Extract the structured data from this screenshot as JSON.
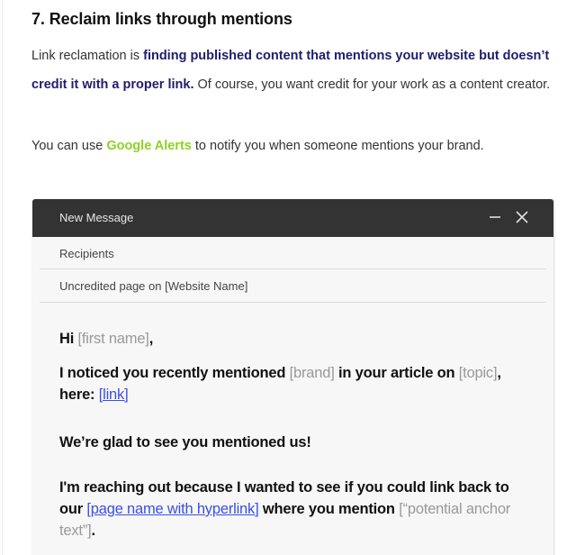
{
  "article": {
    "heading": "7. Reclaim links through mentions",
    "para1": {
      "prefix": "Link reclamation is ",
      "emphasis": "finding published content that mentions your website but doesn’t credit it with a proper link.",
      "suffix": " Of course, you want credit for your work as a content creator."
    },
    "para2": {
      "prefix": "You can use ",
      "link": "Google Alerts",
      "suffix": " to notify you when someone mentions your brand."
    }
  },
  "email": {
    "title": "New Message",
    "controls": {
      "minimize": "minimize-icon",
      "close": "close-icon"
    },
    "recipients_placeholder": "Recipients",
    "subject": "Uncredited page on [Website Name]",
    "greeting": {
      "text": "Hi ",
      "placeholder": "[first name]",
      "suffix": ","
    },
    "line2": {
      "a": "I noticed you recently mentioned ",
      "brand": "[brand]",
      "b": " in your article on ",
      "topic": "[topic]",
      "c": ", here: ",
      "link": "[link]"
    },
    "line3": "We’re glad to see you mentioned us!",
    "line4": {
      "a": "I'm reaching out because I wanted to see if you could link back to our ",
      "link": "[page name with hyperlink]",
      "b": " where you mention ",
      "anchor": "[“potential anchor text”]",
      "c": "."
    }
  },
  "colors": {
    "emphasis": "#1f1d6e",
    "green_link": "#8cd322",
    "email_header": "#333333",
    "email_body": "#f7f7f7",
    "blue_link": "#3a4fe8",
    "placeholder": "#999999"
  }
}
